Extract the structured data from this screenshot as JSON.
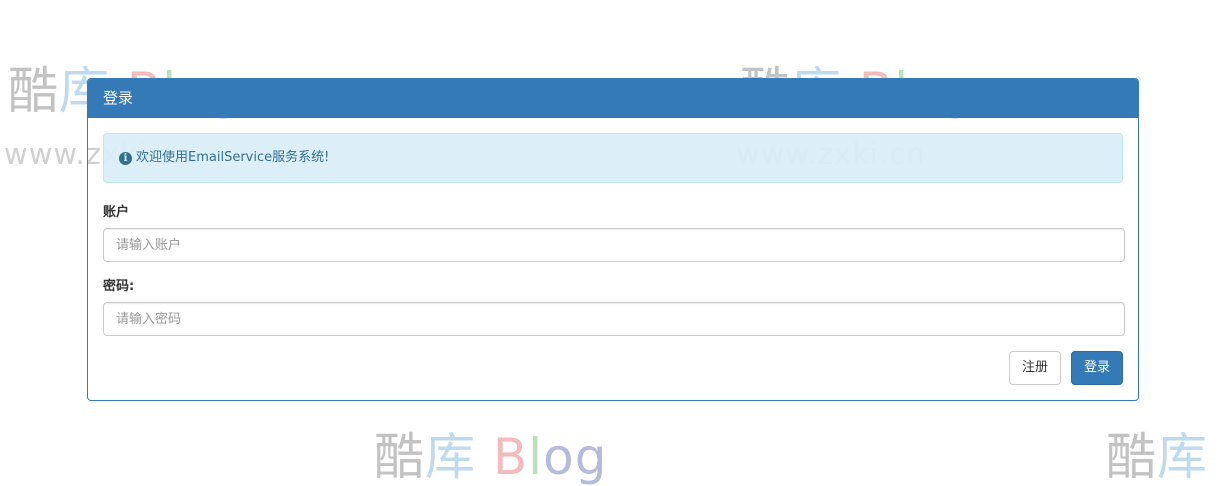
{
  "watermark": {
    "logo_cn": "酷库",
    "logo_cn_1": "酷",
    "logo_cn_2": "库",
    "logo_b": "B",
    "logo_l": "l",
    "logo_og": "og",
    "url": "www.zxki.cn"
  },
  "panel": {
    "title": "登录"
  },
  "alert": {
    "icon": "info-circle-icon",
    "text": "欢迎使用EmailService服务系统!"
  },
  "form": {
    "account": {
      "label": "账户",
      "placeholder": "请输入账户",
      "value": ""
    },
    "password": {
      "label": "密码:",
      "placeholder": "请输入密码",
      "value": ""
    }
  },
  "buttons": {
    "register": "注册",
    "login": "登录"
  },
  "colors": {
    "primary": "#337ab7",
    "alert_bg": "#d9edf7",
    "alert_text": "#31708f"
  }
}
